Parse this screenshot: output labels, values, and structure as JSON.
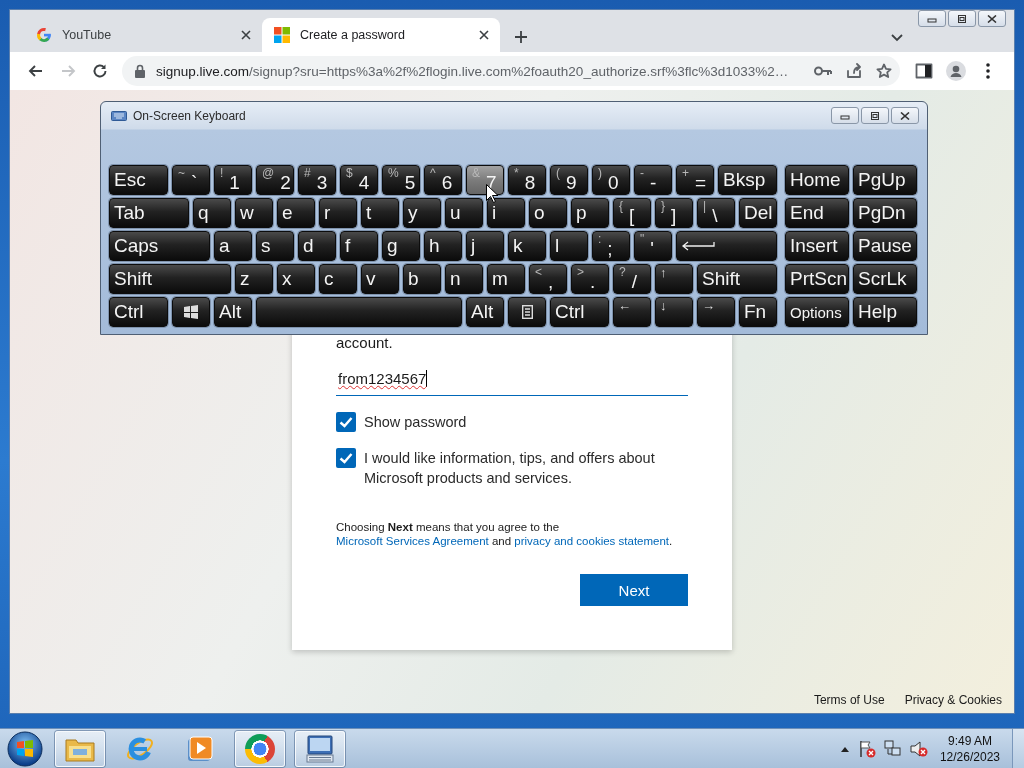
{
  "browser": {
    "tabs": [
      {
        "title": "YouTube",
        "kind": "google",
        "selected": false
      },
      {
        "title": "Create a password",
        "kind": "microsoft",
        "selected": true
      }
    ],
    "nav_buttons": [
      {
        "kind": "back",
        "disabled": false
      },
      {
        "kind": "forward",
        "disabled": true
      },
      {
        "kind": "reload",
        "disabled": false
      }
    ],
    "address": {
      "host": "signup.live.com",
      "path": "/signup?sru=https%3a%2f%2flogin.live.com%2foauth20_authorize.srf%3flc%3d1033%2…"
    }
  },
  "signup": {
    "intro_tail": "account.",
    "password": "from1234567",
    "checkboxes": [
      {
        "label": "Show password",
        "checked": true
      },
      {
        "label": "I would like information, tips, and offers about Microsoft products and services.",
        "checked": true
      }
    ],
    "legal": [
      {
        "kind": "text",
        "text": "Choosing **Next** means that you agree to the "
      },
      {
        "kind": "link",
        "text": "Microsoft Services Agreement"
      },
      {
        "kind": "text",
        "text": " and "
      },
      {
        "kind": "link",
        "text": "privacy and cookies statement"
      },
      {
        "kind": "text",
        "text": "."
      }
    ],
    "button": "Next",
    "footer_links": [
      "Terms of Use",
      "Privacy & Cookies"
    ]
  },
  "keyboard": {
    "title": "On-Screen Keyboard",
    "rows": [
      {
        "keys": [
          {
            "kind": "text",
            "label": "Esc",
            "hovered": false
          },
          {
            "kind": "dual",
            "shift": "~",
            "label": "`",
            "hovered": false
          },
          {
            "kind": "dual",
            "shift": "!",
            "label": "1",
            "hovered": false
          },
          {
            "kind": "dual",
            "shift": "@",
            "label": "2",
            "hovered": false
          },
          {
            "kind": "dual",
            "shift": "#",
            "label": "3",
            "hovered": false
          },
          {
            "kind": "dual",
            "shift": "$",
            "label": "4",
            "hovered": false
          },
          {
            "kind": "dual",
            "shift": "%",
            "label": "5",
            "hovered": false
          },
          {
            "kind": "dual",
            "shift": "^",
            "label": "6",
            "hovered": false
          },
          {
            "kind": "dual",
            "shift": "&",
            "label": "7",
            "hovered": true
          },
          {
            "kind": "dual",
            "shift": "*",
            "label": "8",
            "hovered": false
          },
          {
            "kind": "dual",
            "shift": "(",
            "label": "9",
            "hovered": false
          },
          {
            "kind": "dual",
            "shift": ")",
            "label": "0",
            "hovered": false
          },
          {
            "kind": "dual",
            "shift": "-",
            "label": "-",
            "hovered": false
          },
          {
            "kind": "dual",
            "shift": "+",
            "label": "=",
            "hovered": false
          },
          {
            "kind": "text",
            "label": "Bksp",
            "hovered": false
          }
        ],
        "nav": [
          {
            "kind": "text",
            "label": "Home",
            "hovered": false
          },
          {
            "kind": "text",
            "label": "PgUp",
            "hovered": false
          }
        ]
      },
      {
        "keys": [
          {
            "kind": "text",
            "label": "Tab",
            "hovered": false
          },
          {
            "kind": "text",
            "label": "q",
            "hovered": false
          },
          {
            "kind": "text",
            "label": "w",
            "hovered": false
          },
          {
            "kind": "text",
            "label": "e",
            "hovered": false
          },
          {
            "kind": "text",
            "label": "r",
            "hovered": false
          },
          {
            "kind": "text",
            "label": "t",
            "hovered": false
          },
          {
            "kind": "text",
            "label": "y",
            "hovered": false
          },
          {
            "kind": "text",
            "label": "u",
            "hovered": false
          },
          {
            "kind": "text",
            "label": "i",
            "hovered": false
          },
          {
            "kind": "text",
            "label": "o",
            "hovered": false
          },
          {
            "kind": "text",
            "label": "p",
            "hovered": false
          },
          {
            "kind": "dual",
            "shift": "{",
            "label": "[",
            "hovered": false
          },
          {
            "kind": "dual",
            "shift": "}",
            "label": "]",
            "hovered": false
          },
          {
            "kind": "dual",
            "shift": "|",
            "label": "\\",
            "hovered": false
          },
          {
            "kind": "text",
            "label": "Del",
            "hovered": false
          }
        ],
        "nav": [
          {
            "kind": "text",
            "label": "End",
            "hovered": false
          },
          {
            "kind": "text",
            "label": "PgDn",
            "hovered": false
          }
        ]
      },
      {
        "keys": [
          {
            "kind": "text",
            "label": "Caps",
            "hovered": false
          },
          {
            "kind": "text",
            "label": "a",
            "hovered": false
          },
          {
            "kind": "text",
            "label": "s",
            "hovered": false
          },
          {
            "kind": "text",
            "label": "d",
            "hovered": false
          },
          {
            "kind": "text",
            "label": "f",
            "hovered": false
          },
          {
            "kind": "text",
            "label": "g",
            "hovered": false
          },
          {
            "kind": "text",
            "label": "h",
            "hovered": false
          },
          {
            "kind": "text",
            "label": "j",
            "hovered": false
          },
          {
            "kind": "text",
            "label": "k",
            "hovered": false
          },
          {
            "kind": "text",
            "label": "l",
            "hovered": false
          },
          {
            "kind": "dual",
            "shift": ":",
            "label": ";",
            "hovered": false
          },
          {
            "kind": "dual",
            "shift": "\"",
            "label": "'",
            "hovered": false
          },
          {
            "kind": "enter",
            "hovered": false
          }
        ],
        "nav": [
          {
            "kind": "text",
            "label": "Insert",
            "hovered": false
          },
          {
            "kind": "text",
            "label": "Pause",
            "hovered": false
          }
        ]
      },
      {
        "keys": [
          {
            "kind": "text",
            "label": "Shift",
            "hovered": false
          },
          {
            "kind": "text",
            "label": "z",
            "hovered": false
          },
          {
            "kind": "text",
            "label": "x",
            "hovered": false
          },
          {
            "kind": "text",
            "label": "c",
            "hovered": false
          },
          {
            "kind": "text",
            "label": "v",
            "hovered": false
          },
          {
            "kind": "text",
            "label": "b",
            "hovered": false
          },
          {
            "kind": "text",
            "label": "n",
            "hovered": false
          },
          {
            "kind": "text",
            "label": "m",
            "hovered": false
          },
          {
            "kind": "dual",
            "shift": "<",
            "label": ",",
            "hovered": false
          },
          {
            "kind": "dual",
            "shift": ">",
            "label": ".",
            "hovered": false
          },
          {
            "kind": "dual",
            "shift": "?",
            "label": "/",
            "hovered": false
          },
          {
            "kind": "arrow",
            "label": "↑",
            "hovered": false
          },
          {
            "kind": "text",
            "label": "Shift",
            "hovered": false
          }
        ],
        "nav": [
          {
            "kind": "text",
            "label": "PrtScn",
            "hovered": false
          },
          {
            "kind": "text",
            "label": "ScrLk",
            "hovered": false
          }
        ]
      },
      {
        "keys": [
          {
            "kind": "text",
            "label": "Ctrl",
            "hovered": false
          },
          {
            "kind": "windows",
            "hovered": false
          },
          {
            "kind": "text",
            "label": "Alt",
            "hovered": false
          },
          {
            "kind": "space",
            "hovered": false
          },
          {
            "kind": "text",
            "label": "Alt",
            "hovered": false
          },
          {
            "kind": "menu",
            "hovered": false
          },
          {
            "kind": "text",
            "label": "Ctrl",
            "hovered": false
          },
          {
            "kind": "arrow",
            "label": "←",
            "hovered": false
          },
          {
            "kind": "arrow",
            "label": "↓",
            "hovered": false
          },
          {
            "kind": "arrow",
            "label": "→",
            "hovered": false
          },
          {
            "kind": "text",
            "label": "Fn",
            "hovered": false
          }
        ],
        "nav": [
          {
            "kind": "text",
            "label": "Options",
            "hovered": false
          },
          {
            "kind": "text",
            "label": "Help",
            "hovered": false
          }
        ]
      }
    ]
  },
  "taskbar": {
    "apps": [
      {
        "kind": "explorer",
        "running": true
      },
      {
        "kind": "ie",
        "running": false
      },
      {
        "kind": "media",
        "running": false
      },
      {
        "kind": "chrome",
        "running": true
      },
      {
        "kind": "osk",
        "running": true
      }
    ],
    "clock": {
      "time": "9:49 AM",
      "date": "12/26/2023"
    }
  }
}
